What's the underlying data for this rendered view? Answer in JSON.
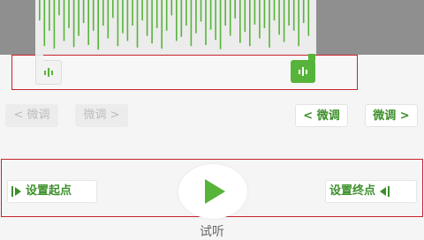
{
  "waveform": {
    "bar_heights": [
      0.4,
      0.9,
      0.6,
      0.95,
      0.3,
      0.8,
      0.55,
      0.92,
      0.7,
      0.45,
      0.88,
      0.6,
      0.97,
      0.5,
      0.75,
      0.35,
      0.9,
      0.65,
      0.8,
      0.5,
      0.93,
      0.4,
      0.7,
      0.85,
      0.55,
      0.95,
      0.6,
      0.3,
      0.8,
      0.72,
      0.5,
      0.9,
      0.65,
      0.42,
      0.88,
      0.58,
      0.78,
      0.96,
      0.5,
      0.7,
      0.36,
      0.84,
      0.62,
      0.9,
      0.48,
      0.75,
      0.55,
      0.93,
      0.4,
      0.68,
      0.82,
      0.5,
      0.6,
      0.9,
      0.45,
      0.7
    ],
    "color": "#57b43a"
  },
  "fine_tune": {
    "start_back": "< 微调",
    "start_fwd": "微调 >",
    "end_back": "< 微调",
    "end_fwd": "微调 >"
  },
  "controls": {
    "set_start": "设置起点",
    "set_end": "设置终点",
    "play_label": "试听"
  },
  "colors": {
    "accent_green": "#57b43a",
    "highlight_red": "#c8232c"
  }
}
